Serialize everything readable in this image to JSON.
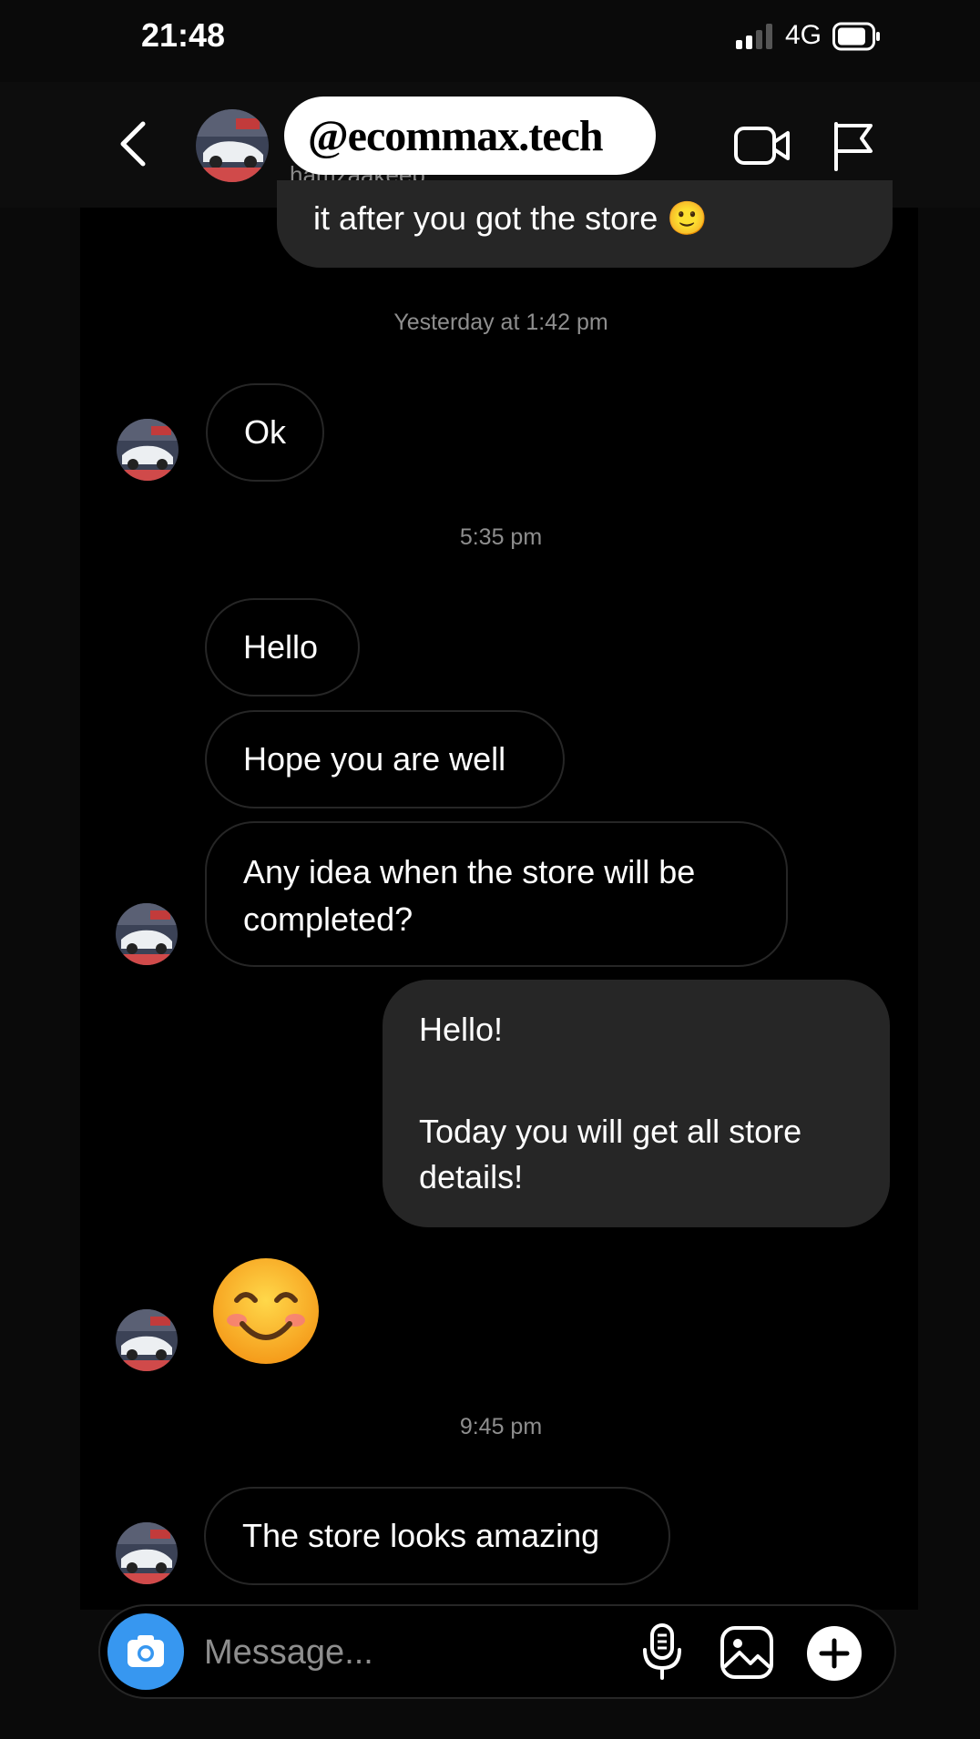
{
  "status_bar": {
    "time": "21:48",
    "network": "4G",
    "battery_icon": "battery-icon",
    "signal_icon": "signal-bars-icon"
  },
  "header": {
    "username": "hamzaakeeb",
    "watermark": "@ecommax.tech",
    "icons": [
      "back-chevron-icon",
      "video-camera-icon",
      "flag-icon"
    ]
  },
  "messages": [
    {
      "side": "out",
      "text": "it after you got the store 🙂"
    },
    {
      "type": "timestamp",
      "text": "Yesterday at 1:42 pm"
    },
    {
      "side": "in",
      "text": "Ok"
    },
    {
      "type": "timestamp",
      "text": "5:35 pm"
    },
    {
      "side": "in",
      "text": "Hello"
    },
    {
      "side": "in",
      "text": "Hope you are well"
    },
    {
      "side": "in",
      "text_line1": "Any idea when the store will be",
      "text_line2": "completed?"
    },
    {
      "side": "out",
      "line1": "Hello!",
      "line2": "Today you will get all store",
      "line3": "details!"
    },
    {
      "side": "in",
      "emoji": "😊"
    },
    {
      "type": "timestamp",
      "text": "9:45 pm"
    },
    {
      "side": "in",
      "text": "The store looks amazing"
    }
  ],
  "composer": {
    "placeholder": "Message...",
    "icons": [
      "camera-icon",
      "microphone-icon",
      "gallery-icon",
      "plus-icon"
    ]
  },
  "colors": {
    "background": "#000000",
    "bubble_out": "#262626",
    "bubble_border": "#262626",
    "camera_button": "#3797f0",
    "timestamp": "#8e8e8e"
  }
}
